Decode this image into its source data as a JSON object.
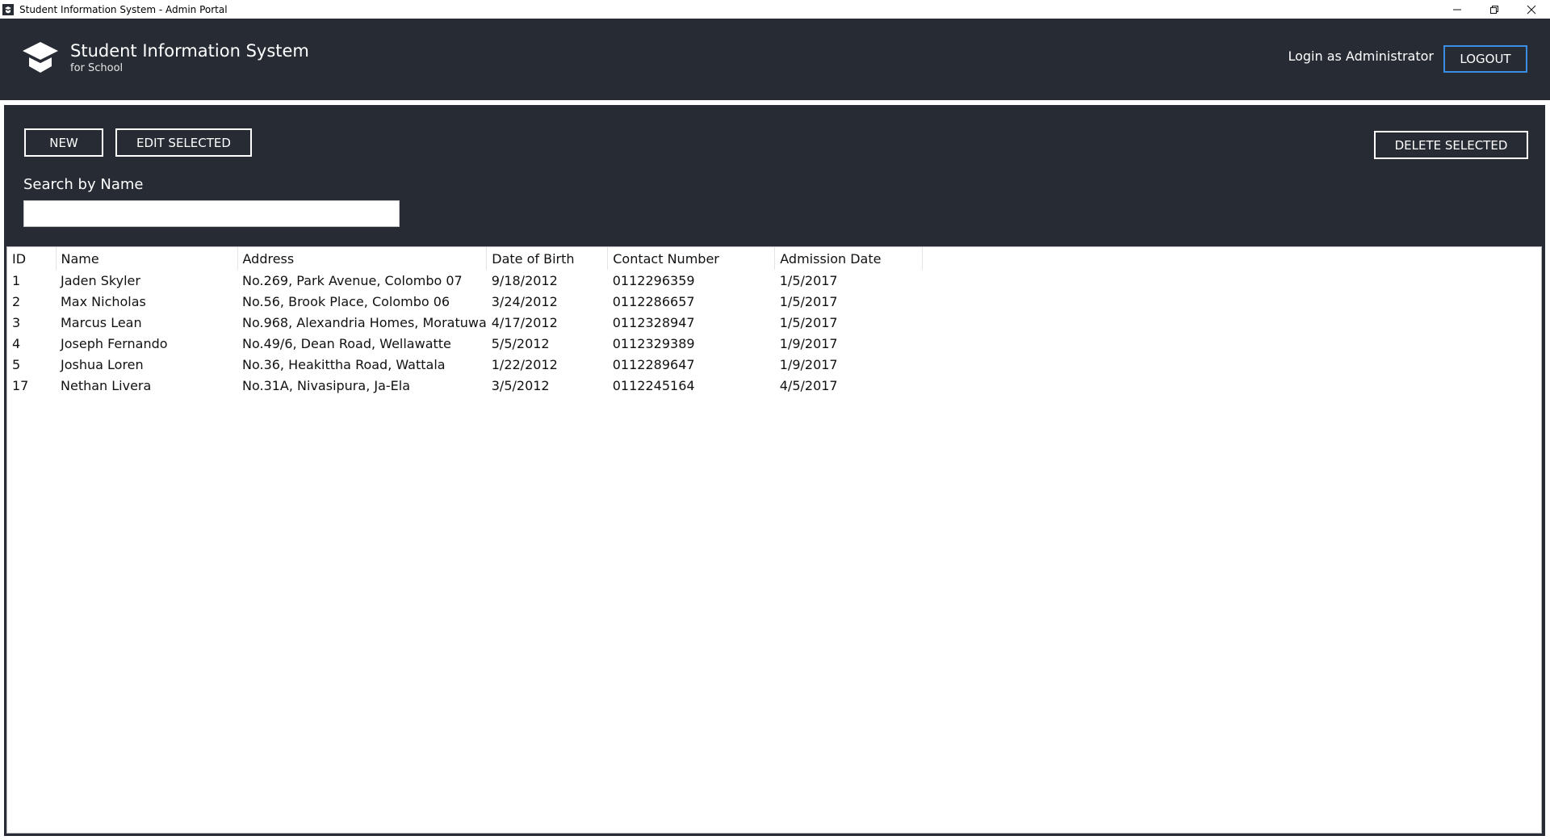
{
  "window": {
    "title": "Student Information System - Admin Portal",
    "controls": [
      "minimize-icon",
      "restore-icon",
      "close-icon"
    ]
  },
  "header": {
    "title": "Student Information System",
    "subtitle": "for School",
    "login_label": "Login as Administrator",
    "logout_label": "LOGOUT"
  },
  "toolbar": {
    "new_label": "NEW",
    "edit_label": "EDIT SELECTED",
    "delete_label": "DELETE SELECTED"
  },
  "search": {
    "label": "Search by Name",
    "value": "",
    "placeholder": ""
  },
  "table": {
    "columns": [
      "ID",
      "Name",
      "Address",
      "Date of Birth",
      "Contact Number",
      "Admission Date"
    ],
    "rows": [
      [
        "1",
        "Jaden Skyler",
        "No.269, Park Avenue, Colombo 07",
        "9/18/2012",
        "0112296359",
        "1/5/2017"
      ],
      [
        "2",
        "Max Nicholas",
        "No.56, Brook Place, Colombo 06",
        "3/24/2012",
        "0112286657",
        "1/5/2017"
      ],
      [
        "3",
        "Marcus Lean",
        "No.968, Alexandria Homes, Moratuwa",
        "4/17/2012",
        "0112328947",
        "1/5/2017"
      ],
      [
        "4",
        "Joseph Fernando",
        "No.49/6, Dean Road, Wellawatte",
        "5/5/2012",
        "0112329389",
        "1/9/2017"
      ],
      [
        "5",
        "Joshua Loren",
        "No.36, Heakittha Road, Wattala",
        "1/22/2012",
        "0112289647",
        "1/9/2017"
      ],
      [
        "17",
        "Nethan Livera",
        "No.31A, Nivasipura, Ja-Ela",
        "3/5/2012",
        "0112245164",
        "4/5/2017"
      ]
    ]
  },
  "colors": {
    "header_bg": "#262b34",
    "panel_bg": "#262b34",
    "accent": "#3b8ee6",
    "text_light": "#ffffff"
  }
}
